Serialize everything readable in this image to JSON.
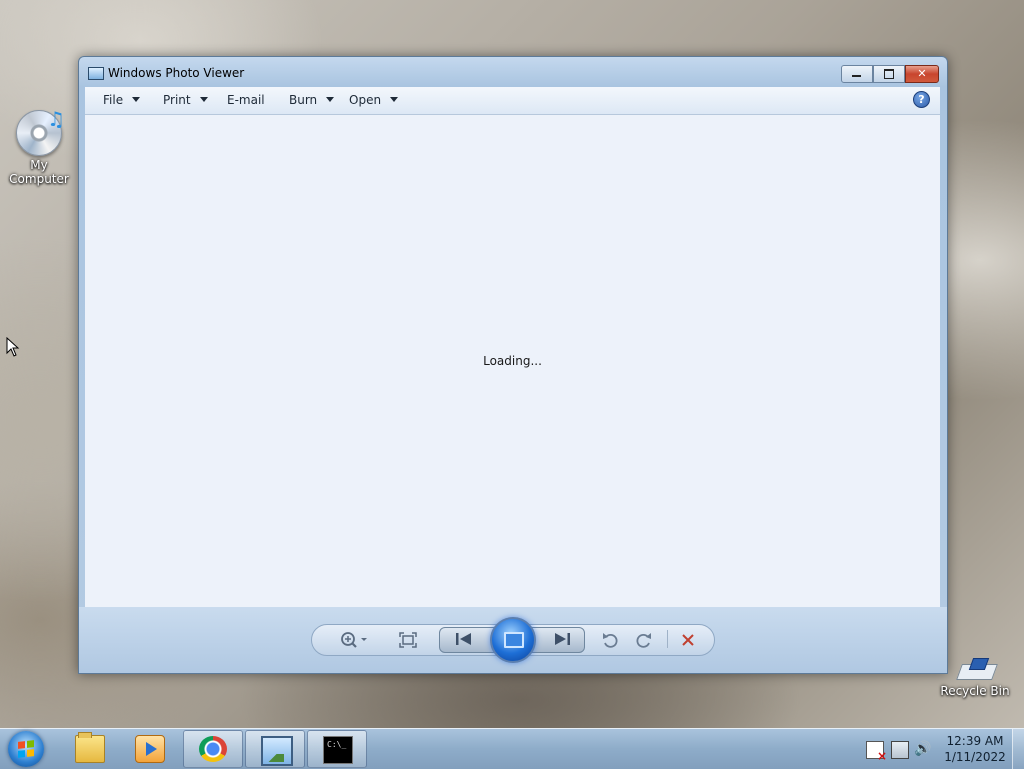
{
  "desktop": {
    "icons": [
      {
        "label": "My Computer",
        "icon": "cd-music-icon"
      },
      {
        "label": "Recycle Bin",
        "icon": "recycle-bin-icon"
      }
    ]
  },
  "window": {
    "title": "Windows Photo Viewer",
    "controls": {
      "minimize": "minimize",
      "maximize": "maximize",
      "close": "close"
    },
    "menu": [
      {
        "label": "File",
        "has_dropdown": true
      },
      {
        "label": "Print",
        "has_dropdown": true
      },
      {
        "label": "E-mail",
        "has_dropdown": false
      },
      {
        "label": "Burn",
        "has_dropdown": true
      },
      {
        "label": "Open",
        "has_dropdown": true
      }
    ],
    "help_symbol": "?",
    "status_text": "Loading...",
    "toolbar": [
      "zoom",
      "actual-size",
      "previous",
      "slideshow",
      "next",
      "rotate-counterclockwise",
      "rotate-clockwise",
      "delete"
    ]
  },
  "taskbar": {
    "items": [
      "start",
      "windows-explorer",
      "windows-media-player",
      "google-chrome",
      "windows-photo-viewer",
      "command-prompt"
    ],
    "active_item": "windows-photo-viewer",
    "clock": {
      "time": "12:39 AM",
      "date": "1/11/2022"
    }
  },
  "colors": {
    "viewer_bg": "#edf2fa",
    "titlebar": "#c4d8ee",
    "close_button": "#c8452e",
    "taskbar": "#8eacc9"
  }
}
